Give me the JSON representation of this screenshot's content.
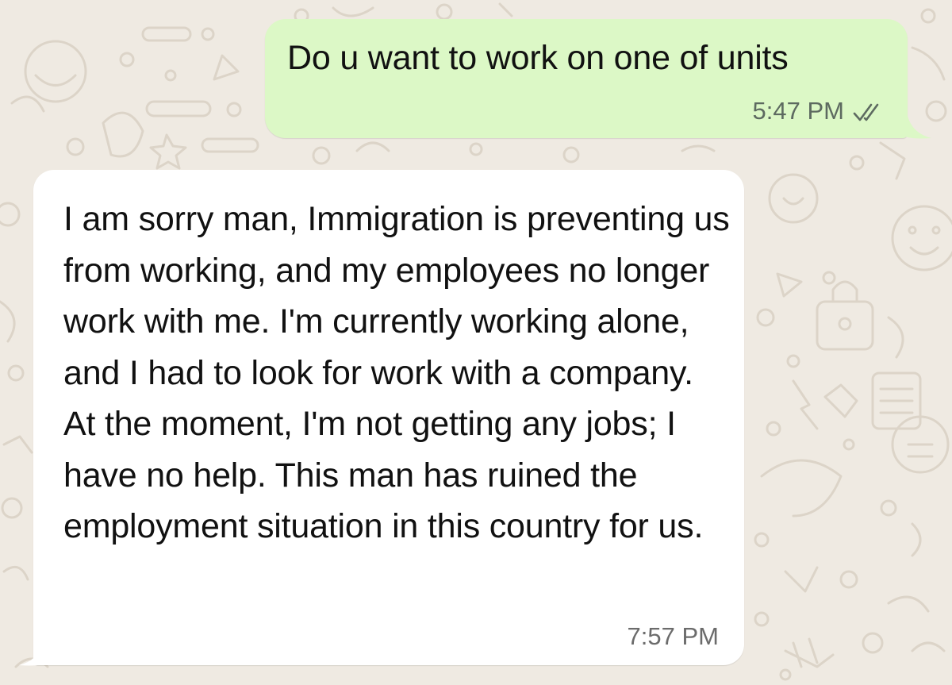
{
  "chat": {
    "outgoing": {
      "text": "Do u want to work on one of units",
      "time": "5:47 PM",
      "status_icon": "double-check-icon"
    },
    "incoming": {
      "text": "I am sorry man, Immigration is preventing us from working, and my employees no longer work with me. I'm currently working alone, and I had to look for work with a company. At the moment, I'm not getting any jobs; I have no help. This man has ruined the employment situation in this country for us.",
      "time": "7:57 PM"
    }
  },
  "colors": {
    "background": "#efeae2",
    "outgoing_bubble": "#dcf8c6",
    "incoming_bubble": "#ffffff",
    "doodle": "#ddd6cc"
  }
}
